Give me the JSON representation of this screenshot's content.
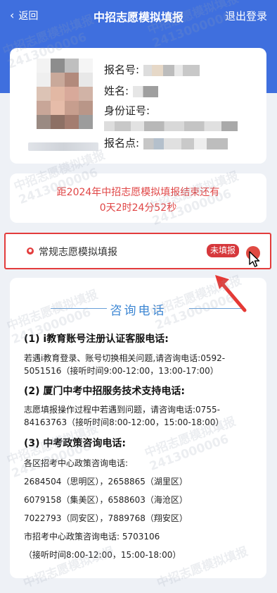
{
  "header": {
    "back_label": "返回",
    "title": "中招志愿模拟填报",
    "logout_label": "退出登录",
    "bg_color": "#3f6fde"
  },
  "profile": {
    "reg_no_label": "报名号:",
    "name_label": "姓名:",
    "id_label": "身份证号:",
    "site_label": "报名点:"
  },
  "countdown": {
    "line1": "距2024年中招志愿模拟填报结束还有",
    "line2": "0天2时24分52秒",
    "color": "#e04545"
  },
  "fill_item": {
    "label": "常规志愿模拟填报",
    "status": "未填报",
    "icon": "hot-icon"
  },
  "contact": {
    "title": "咨询电话",
    "sec1_head": "(1) i教育账号注册认证客服电话:",
    "sec1_text": "若遇i教育登录、账号切换相关问题,请咨询电话:0592-5051516（接听时间9:00-12:00，13:00-17:00）",
    "sec2_head": "(2) 厦门中考中招服务技术支持电话:",
    "sec2_text": "志愿填报操作过程中若遇到问题，请咨询电话:0755-84163763（接听时间8:00-12:00，15:00-18:00）",
    "sec3_head": "(3) 中考政策咨询电话:",
    "sec3_line1": "各区招考中心政策咨询电话:",
    "sec3_line2": "2684504（思明区），2658865（湖里区）",
    "sec3_line3": "6079158（集美区），6588603（海沧区）",
    "sec3_line4": "7022793（同安区），7889768（翔安区）",
    "sec3_line5": "市招考中心政策咨询电话: 5703106",
    "sec3_line6": "（接听时间8:00-12:00，15:00-18:00）"
  },
  "watermark": {
    "name": "中招志愿模拟填报",
    "id": "2413000006"
  }
}
